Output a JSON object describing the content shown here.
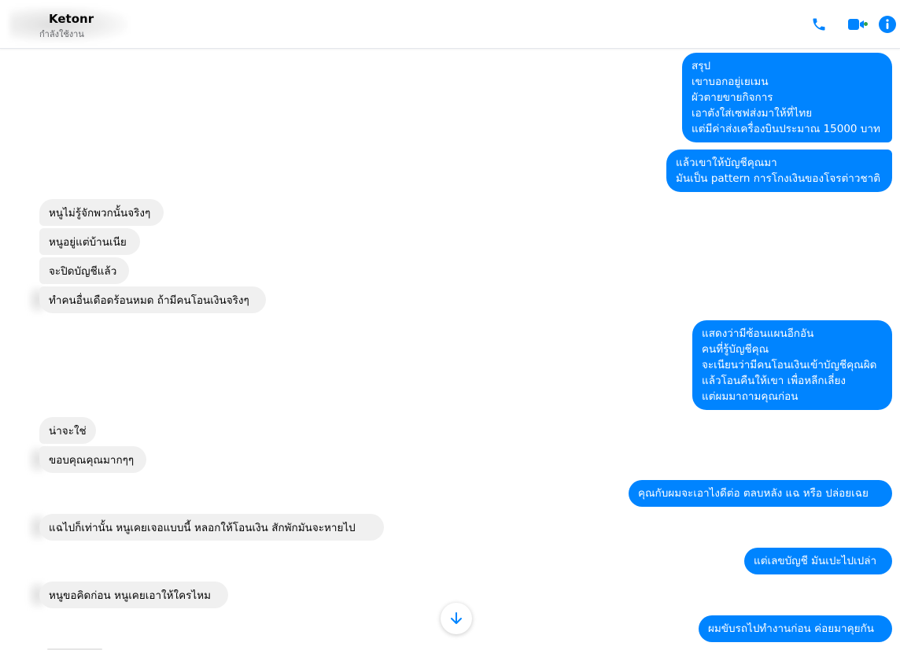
{
  "header": {
    "contact_name": "Ketonr",
    "status": "กำลังใช้งาน",
    "icons": [
      "phone-icon",
      "video-camera-icon",
      "info-icon"
    ],
    "accent": "#0084ff",
    "online_color": "#31a24c"
  },
  "messages": [
    {
      "dir": "out",
      "text": "สรุป\nเขาบอกอยู่เยเมน\nผัวตายขายกิจการ\nเอาตังใส่เซฟส่งมาให้ที่ไทย\nแต่มีค่าส่งเครื่องบินประมาณ 15000 บาท"
    },
    {
      "dir": "out",
      "text": "แล้วเขาให้บัญชีคุณมา\nมันเป็น pattern การโกงเงินของโจรต่าวชาติ"
    },
    {
      "dir": "in",
      "text": "หนูไม่รู้จักพวกนั้นจริงๆ"
    },
    {
      "dir": "in",
      "text": "หนูอยู่แต่บ้านเนีย"
    },
    {
      "dir": "in",
      "text": "จะปิดบัญชีแล้ว"
    },
    {
      "dir": "in",
      "text": "ทำคนอื่นเดือดร้อนหมด ถ้ามีคนโอนเงินจริงๆ"
    },
    {
      "dir": "out",
      "text": "แสดงว่ามีซ้อนแผนอีกอัน\nคนที่รู้บัญชีคุณ\nจะเนียนว่ามีคนโอนเงินเข้าบัญชีคุณผิด\nแล้วโอนคืนให้เขา เพื่อหลีกเลี่ยง\nแต่ผมมาถามคุณก่อน"
    },
    {
      "dir": "in",
      "text": "น่าจะใช่"
    },
    {
      "dir": "in",
      "text": "ขอบคุณคุณมากๆๆ"
    },
    {
      "dir": "out",
      "text": "คุณกับผมจะเอาไงดีต่อ ตลบหลัง แฉ หรือ ปล่อยเฉย"
    },
    {
      "dir": "in",
      "text": "แฉไปก็เท่านั้น หนูเคยเจอแบบนี้ หลอกให้โอนเงิน สักพักมันจะหายไป"
    },
    {
      "dir": "out",
      "text": "แต่เลขบัญชี มันเปะไปเปล่า"
    },
    {
      "dir": "in",
      "text": "หนูขอคิดก่อน หนูเคยเอาให้ใครไหม"
    },
    {
      "dir": "out",
      "text": "ผมขับรถไปทำงานก่อน ค่อยมาคุยกัน"
    }
  ],
  "scroll_button_icon": "arrow-down-icon"
}
